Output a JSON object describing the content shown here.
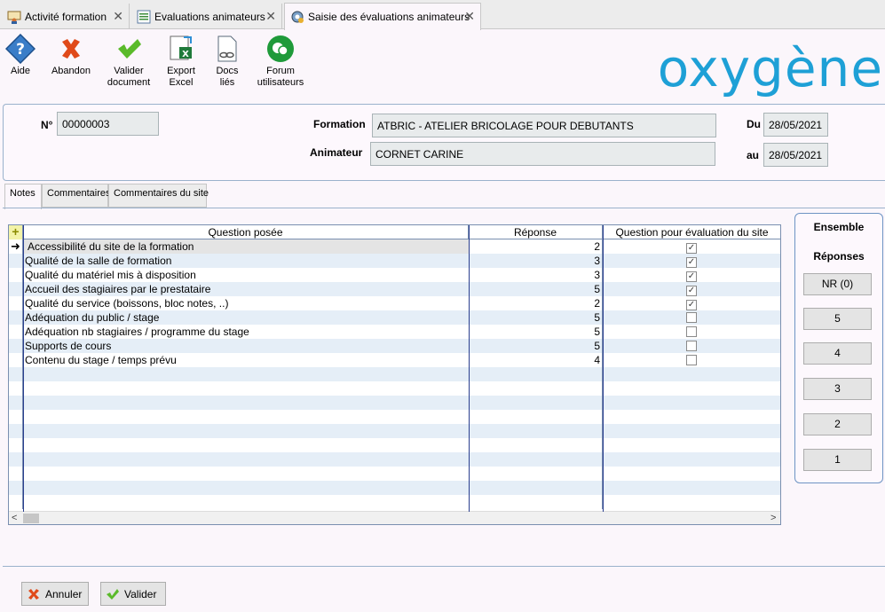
{
  "tabs": [
    {
      "label": "Activité formation",
      "icon": "training-icon",
      "active": false
    },
    {
      "label": "Evaluations animateurs",
      "icon": "list-icon",
      "active": false
    },
    {
      "label": "Saisie des évaluations animateurs",
      "icon": "gear-icon",
      "active": true
    }
  ],
  "toolbar": {
    "help": "Aide",
    "abandon": "Abandon",
    "validate_1": "Valider",
    "validate_2": "document",
    "export_1": "Export",
    "export_2": "Excel",
    "docs_1": "Docs",
    "docs_2": "liés",
    "forum_1": "Forum",
    "forum_2": "utilisateurs"
  },
  "logo": "oxygène",
  "form": {
    "num_label": "N°",
    "num_value": "00000003",
    "formation_label": "Formation",
    "formation_value": "ATBRIC - ATELIER BRICOLAGE POUR DEBUTANTS",
    "animateur_label": "Animateur",
    "animateur_value": "CORNET CARINE",
    "du_label": "Du",
    "du_value": "28/05/2021",
    "au_label": "au",
    "au_value": "28/05/2021"
  },
  "subtabs": [
    "Notes",
    "Commentaires",
    "Commentaires du site"
  ],
  "grid": {
    "headers": [
      "Question posée",
      "Réponse",
      "Question pour évaluation du site"
    ],
    "rows": [
      {
        "question": "Accessibilité du site de la formation",
        "answer": "2",
        "site": true
      },
      {
        "question": "Qualité de la salle de formation",
        "answer": "3",
        "site": true
      },
      {
        "question": "Qualité du matériel mis à disposition",
        "answer": "3",
        "site": true
      },
      {
        "question": "Accueil des stagiaires par le prestataire",
        "answer": "5",
        "site": true
      },
      {
        "question": "Qualité du service (boissons, bloc notes, ..)",
        "answer": "2",
        "site": true
      },
      {
        "question": "Adéquation du public / stage",
        "answer": "5",
        "site": false
      },
      {
        "question": "Adéquation nb stagiaires / programme du stage",
        "answer": "5",
        "site": false
      },
      {
        "question": "Supports de cours",
        "answer": "5",
        "site": false
      },
      {
        "question": "Contenu du stage / temps prévu",
        "answer": "4",
        "site": false
      }
    ]
  },
  "side": {
    "title": "Ensemble",
    "subtitle": "Réponses",
    "buttons": [
      "NR (0)",
      "5",
      "4",
      "3",
      "2",
      "1"
    ]
  },
  "footer": {
    "cancel": "Annuler",
    "validate": "Valider"
  }
}
